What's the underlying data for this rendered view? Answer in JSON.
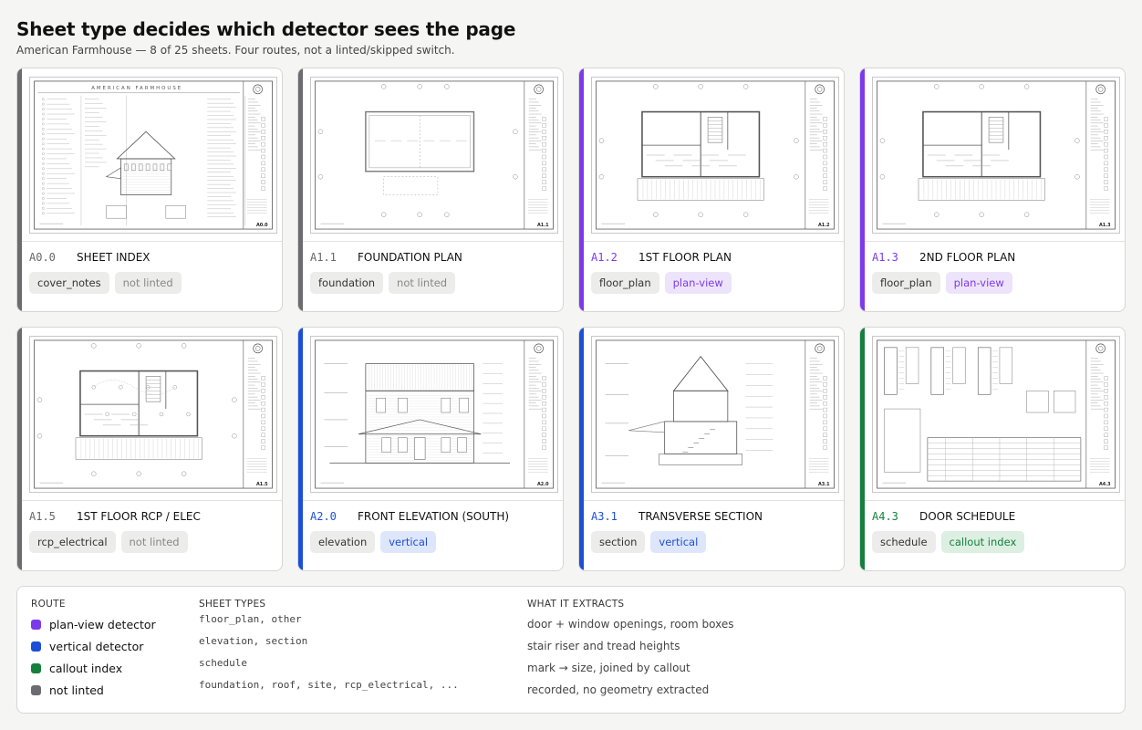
{
  "header": {
    "title": "Sheet type decides which detector sees the page",
    "subtitle": "American Farmhouse — 8 of 25 sheets. Four routes, not a linted/skipped switch."
  },
  "colors": {
    "plan_view": "#7c3aed",
    "vertical": "#1d4ed8",
    "callout": "#15803d",
    "not_linted": "#6b6b70"
  },
  "sheets": [
    {
      "code": "A0.0",
      "name": "SHEET INDEX",
      "type": "cover_notes",
      "route_label": "not linted",
      "route": "not_linted",
      "sheet_no": "A0.0",
      "banner": "AMERICAN FARMHOUSE"
    },
    {
      "code": "A1.1",
      "name": "FOUNDATION PLAN",
      "type": "foundation",
      "route_label": "not linted",
      "route": "not_linted",
      "sheet_no": "A1.1"
    },
    {
      "code": "A1.2",
      "name": "1ST FLOOR PLAN",
      "type": "floor_plan",
      "route_label": "plan-view",
      "route": "plan_view",
      "sheet_no": "A1.2"
    },
    {
      "code": "A1.3",
      "name": "2ND FLOOR PLAN",
      "type": "floor_plan",
      "route_label": "plan-view",
      "route": "plan_view",
      "sheet_no": "A1.3"
    },
    {
      "code": "A1.5",
      "name": "1ST FLOOR RCP / ELEC",
      "type": "rcp_electrical",
      "route_label": "not linted",
      "route": "not_linted",
      "sheet_no": "A1.5"
    },
    {
      "code": "A2.0",
      "name": "FRONT ELEVATION (SOUTH)",
      "type": "elevation",
      "route_label": "vertical",
      "route": "vertical",
      "sheet_no": "A2.0"
    },
    {
      "code": "A3.1",
      "name": "TRANSVERSE SECTION",
      "type": "section",
      "route_label": "vertical",
      "route": "vertical",
      "sheet_no": "A3.1"
    },
    {
      "code": "A4.3",
      "name": "DOOR SCHEDULE",
      "type": "schedule",
      "route_label": "callout index",
      "route": "callout",
      "sheet_no": "A4.3"
    }
  ],
  "legend": {
    "headers": {
      "route": "ROUTE",
      "types": "SHEET TYPES",
      "extracts": "WHAT IT EXTRACTS"
    },
    "rows": [
      {
        "route": "plan-view detector",
        "key": "plan_view",
        "types": "floor_plan, other",
        "extracts": "door + window openings, room boxes"
      },
      {
        "route": "vertical detector",
        "key": "vertical",
        "types": "elevation, section",
        "extracts": "stair riser and tread heights"
      },
      {
        "route": "callout index",
        "key": "callout",
        "types": "schedule",
        "extracts": "mark → size, joined by callout"
      },
      {
        "route": "not linted",
        "key": "not_linted",
        "types": "foundation, roof, site, rcp_electrical, ...",
        "extracts": "recorded, no geometry extracted"
      }
    ]
  }
}
